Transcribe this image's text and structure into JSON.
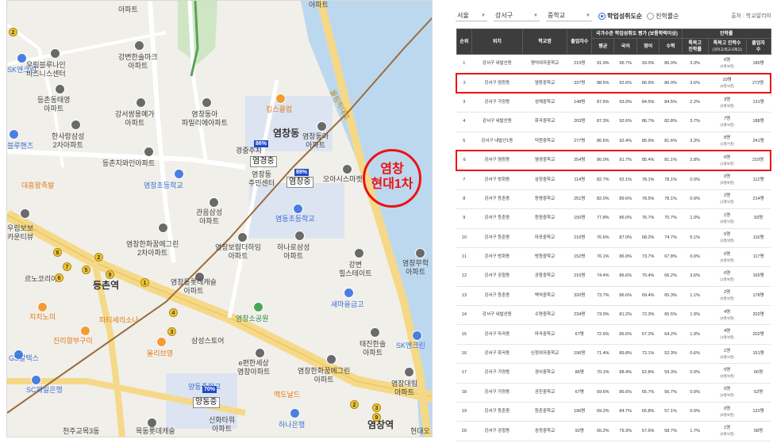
{
  "map": {
    "highlight_label_line1": "염창",
    "highlight_label_line2": "현대1차",
    "places": [
      {
        "id": "p1",
        "text": "우림블루나인\n비즈니스센터"
      },
      {
        "id": "p2",
        "text": "강변한솔마크\n아파트"
      },
      {
        "id": "p3",
        "text": "SK엔크린"
      },
      {
        "id": "p4",
        "text": "등촌동태영\n아파트"
      },
      {
        "id": "p5",
        "text": "강서쌍용예가\n아파트"
      },
      {
        "id": "p6",
        "text": "염창동아\n파밀리에아파트"
      },
      {
        "id": "p7",
        "text": "킴스클럽"
      },
      {
        "id": "p8",
        "text": "블루핸즈"
      },
      {
        "id": "p9",
        "text": "한사랑삼성\n2차아파트"
      },
      {
        "id": "p10",
        "text": "등촌지와인아파트"
      },
      {
        "id": "p11",
        "text": "염창동"
      },
      {
        "id": "p12",
        "text": "염창동아\n아파트"
      },
      {
        "id": "p13",
        "text": "경중주차"
      },
      {
        "id": "p14",
        "text": "염창동\n주민센터"
      },
      {
        "id": "p15",
        "text": "오아시스마켓"
      },
      {
        "id": "p16",
        "text": "대흥왕족발"
      },
      {
        "id": "p17",
        "text": "염창초등학교"
      },
      {
        "id": "p18",
        "text": "관음삼성\n아파트"
      },
      {
        "id": "p19",
        "text": "염동초등학교"
      },
      {
        "id": "p20",
        "text": "우림보보\n카운티뷰"
      },
      {
        "id": "p21",
        "text": "염창한화꿈에그린\n2차아파트"
      },
      {
        "id": "p22",
        "text": "염창보람더하임\n아파트"
      },
      {
        "id": "p23",
        "text": "하나로삼성\n아파트"
      },
      {
        "id": "p24",
        "text": "강변\n힐스테이트"
      },
      {
        "id": "p25",
        "text": "염창무학\n아파트"
      },
      {
        "id": "p26",
        "text": "르노코리아"
      },
      {
        "id": "p27",
        "text": "등촌역"
      },
      {
        "id": "p28",
        "text": "염창동롯데캐슬\n아파트"
      },
      {
        "id": "p29",
        "text": "새마을금고"
      },
      {
        "id": "p30",
        "text": "지치노미"
      },
      {
        "id": "p31",
        "text": "파티세리소나"
      },
      {
        "id": "p32",
        "text": "염창소공원"
      },
      {
        "id": "p33",
        "text": "진리향부구이"
      },
      {
        "id": "p34",
        "text": "삼성스토어"
      },
      {
        "id": "p35",
        "text": "태진한솔\n아파트"
      },
      {
        "id": "p36",
        "text": "SK엔크린"
      },
      {
        "id": "p37",
        "text": "GS칼텍스"
      },
      {
        "id": "p38",
        "text": "올리브영"
      },
      {
        "id": "p39",
        "text": "e편한세상\n염창아파트"
      },
      {
        "id": "p40",
        "text": "SC제일은행"
      },
      {
        "id": "p41",
        "text": "염창한화꿈에그린\n아파트"
      },
      {
        "id": "p42",
        "text": "염창대림\n아파트"
      },
      {
        "id": "p43",
        "text": "양동중학교"
      },
      {
        "id": "p44",
        "text": "맥도날드"
      },
      {
        "id": "p45",
        "text": "천주교목3동"
      },
      {
        "id": "p46",
        "text": "목동롯데캐슬"
      },
      {
        "id": "p47",
        "text": "신화타워\n아파트"
      },
      {
        "id": "p48",
        "text": "하나은행"
      },
      {
        "id": "p49",
        "text": "염창역"
      },
      {
        "id": "p50",
        "text": "현대오"
      },
      {
        "id": "p51",
        "text": "올림픽대로"
      },
      {
        "id": "p52",
        "text": "아파트"
      },
      {
        "id": "p53",
        "text": "아파트"
      }
    ],
    "school_tags": [
      {
        "id": "s1",
        "pct": "86%",
        "name": "염경중"
      },
      {
        "id": "s2",
        "pct": "89%",
        "name": "염창중"
      },
      {
        "id": "s3",
        "pct": "70%",
        "name": "양동중"
      }
    ]
  },
  "panel": {
    "filters": {
      "city": "서울",
      "district": "강서구",
      "level": "중학교"
    },
    "radios": [
      {
        "label": "학업성취도순",
        "selected": true
      },
      {
        "label": "진학률순",
        "selected": false
      }
    ],
    "source": "출처 : 학교알리미",
    "headers": {
      "rank": "순위",
      "loc": "위치",
      "school": "학교명",
      "students": "졸업자수",
      "group_eval": "국가수준 학업성취도 평가 (보통학력이상)",
      "avg": "평균",
      "kor": "국어",
      "eng": "영어",
      "math": "수학",
      "group_adv": "진학률",
      "special": "특목고\n진학률",
      "special_cnt": "특목고 진학수",
      "special_cnt_sub": "(과학고/외고국제고)",
      "graduates": "졸업자\n수"
    },
    "rows": [
      {
        "rank": "1",
        "loc": "강서구 내발산동",
        "school": "명덕여자중학교",
        "students": "215명",
        "avg": "91.9%",
        "kor": "96.7%",
        "eng": "93.0%",
        "math": "86.0%",
        "sp": "3.3%",
        "cnt": "6명",
        "cnt_sub": "(0명/6명)",
        "grad": "180명",
        "hl": false
      },
      {
        "rank": "2",
        "loc": "강서구 염창동",
        "school": "염창중학교",
        "students": "337명",
        "avg": "88.5%",
        "kor": "92.6%",
        "eng": "86.9%",
        "math": "86.0%",
        "sp": "3.6%",
        "cnt": "10명",
        "cnt_sub": "(6명/4명)",
        "grad": "272명",
        "hl": true
      },
      {
        "rank": "3",
        "loc": "강서구 가양동",
        "school": "성재중학교",
        "students": "148명",
        "avg": "87.6%",
        "kor": "93.9%",
        "eng": "84.5%",
        "math": "84.5%",
        "sp": "2.2%",
        "cnt": "3명",
        "cnt_sub": "(0명/3명)",
        "grad": "131명",
        "hl": false
      },
      {
        "rank": "4",
        "loc": "강서구 내발산동",
        "school": "화곡중학교",
        "students": "203명",
        "avg": "87.3%",
        "kor": "92.6%",
        "eng": "86.7%",
        "math": "82.8%",
        "sp": "3.7%",
        "cnt": "7명",
        "cnt_sub": "(3명/4명)",
        "grad": "188명",
        "hl": false
      },
      {
        "rank": "5",
        "loc": "강서구 내발산1동",
        "school": "덕원중학교",
        "students": "277명",
        "avg": "86.6%",
        "kor": "92.4%",
        "eng": "85.9%",
        "math": "81.6%",
        "sp": "3.3%",
        "cnt": "8명",
        "cnt_sub": "(1명/7명)",
        "grad": "241명",
        "hl": false
      },
      {
        "rank": "6",
        "loc": "강서구 염창동",
        "school": "염경중학교",
        "students": "254명",
        "avg": "86.0%",
        "kor": "91.7%",
        "eng": "85.4%",
        "math": "81.1%",
        "sp": "2.8%",
        "cnt": "6명",
        "cnt_sub": "(1명/5명)",
        "grad": "210명",
        "hl": true
      },
      {
        "rank": "7",
        "loc": "강서구 방화동",
        "school": "삼정중학교",
        "students": "114명",
        "avg": "82.7%",
        "kor": "92.1%",
        "eng": "78.1%",
        "math": "78.1%",
        "sp": "0.0%",
        "cnt": "0명",
        "cnt_sub": "(0명/0명)",
        "grad": "112명",
        "hl": false
      },
      {
        "rank": "8",
        "loc": "강서구 등촌동",
        "school": "등명중학교",
        "students": "251명",
        "avg": "82.0%",
        "kor": "89.6%",
        "eng": "78.5%",
        "math": "78.1%",
        "sp": "0.9%",
        "cnt": "2명",
        "cnt_sub": "(1명/1명)",
        "grad": "214명",
        "hl": false
      },
      {
        "rank": "9",
        "loc": "강서구 등촌동",
        "school": "등원중학교",
        "students": "150명",
        "avg": "77.8%",
        "kor": "86.0%",
        "eng": "76.7%",
        "math": "70.7%",
        "sp": "1.0%",
        "cnt": "1명",
        "cnt_sub": "(0명/1명)",
        "grad": "93명",
        "hl": false
      },
      {
        "rank": "10",
        "loc": "강서구 등촌동",
        "school": "마포중학교",
        "students": "216명",
        "avg": "76.6%",
        "kor": "87.0%",
        "eng": "68.2%",
        "math": "74.7%",
        "sp": "5.1%",
        "cnt": "6명",
        "cnt_sub": "(3명/3명)",
        "grad": "116명",
        "hl": false
      },
      {
        "rank": "11",
        "loc": "강서구 방화동",
        "school": "방원중학교",
        "students": "152명",
        "avg": "76.1%",
        "kor": "86.9%",
        "eng": "73.7%",
        "math": "67.8%",
        "sp": "0.0%",
        "cnt": "0명",
        "cnt_sub": "(0명/0명)",
        "grad": "117명",
        "hl": false
      },
      {
        "rank": "12",
        "loc": "강서구 공항동",
        "school": "공항중학교",
        "students": "216명",
        "avg": "74.4%",
        "kor": "86.6%",
        "eng": "70.4%",
        "math": "66.2%",
        "sp": "3.6%",
        "cnt": "6명",
        "cnt_sub": "(1명/5명)",
        "grad": "165명",
        "hl": false
      },
      {
        "rank": "13",
        "loc": "강서구 등촌동",
        "school": "백석중학교",
        "students": "320명",
        "avg": "73.7%",
        "kor": "86.6%",
        "eng": "69.4%",
        "math": "65.3%",
        "sp": "1.1%",
        "cnt": "2명",
        "cnt_sub": "(0명/2명)",
        "grad": "178명",
        "hl": false
      },
      {
        "rank": "14",
        "loc": "강서구 내발산동",
        "school": "수명중학교",
        "students": "234명",
        "avg": "73.0%",
        "kor": "81.2%",
        "eng": "72.3%",
        "math": "65.5%",
        "sp": "1.9%",
        "cnt": "4명",
        "cnt_sub": "(0명/4명)",
        "grad": "202명",
        "hl": false
      },
      {
        "rank": "15",
        "loc": "강서구 마곡동",
        "school": "마곡중학교",
        "students": "67명",
        "avg": "72.6%",
        "kor": "86.6%",
        "eng": "67.2%",
        "math": "64.2%",
        "sp": "1.9%",
        "cnt": "4명",
        "cnt_sub": "(1명/3명)",
        "grad": "202명",
        "hl": false
      },
      {
        "rank": "16",
        "loc": "강서구 화곡동",
        "school": "신정여자중학교",
        "students": "196명",
        "avg": "71.4%",
        "kor": "89.8%",
        "eng": "72.1%",
        "math": "52.3%",
        "sp": "0.6%",
        "cnt": "1명",
        "cnt_sub": "(0명/1명)",
        "grad": "151명",
        "hl": false
      },
      {
        "rank": "17",
        "loc": "강서구 가양동",
        "school": "경서중학교",
        "students": "86명",
        "avg": "70.1%",
        "kor": "88.4%",
        "eng": "62.8%",
        "math": "59.3%",
        "sp": "0.0%",
        "cnt": "0명",
        "cnt_sub": "(0명/0명)",
        "grad": "66명",
        "hl": false
      },
      {
        "rank": "18",
        "loc": "강서구 가양동",
        "school": "공진중학교",
        "students": "67명",
        "avg": "69.6%",
        "kor": "86.6%",
        "eng": "65.7%",
        "math": "56.7%",
        "sp": "0.0%",
        "cnt": "0명",
        "cnt_sub": "(0명/0명)",
        "grad": "52명",
        "hl": false
      },
      {
        "rank": "19",
        "loc": "강서구 등촌동",
        "school": "등촌중학교",
        "students": "196명",
        "avg": "69.2%",
        "kor": "84.7%",
        "eng": "65.8%",
        "math": "57.1%",
        "sp": "0.0%",
        "cnt": "0명",
        "cnt_sub": "(0명/0명)",
        "grad": "122명",
        "hl": false
      },
      {
        "rank": "20",
        "loc": "강서구 공항동",
        "school": "송정중학교",
        "students": "92명",
        "avg": "65.2%",
        "kor": "79.3%",
        "eng": "57.6%",
        "math": "58.7%",
        "sp": "1.7%",
        "cnt": "1명",
        "cnt_sub": "(0명/1명)",
        "grad": "58명",
        "hl": false
      }
    ]
  }
}
